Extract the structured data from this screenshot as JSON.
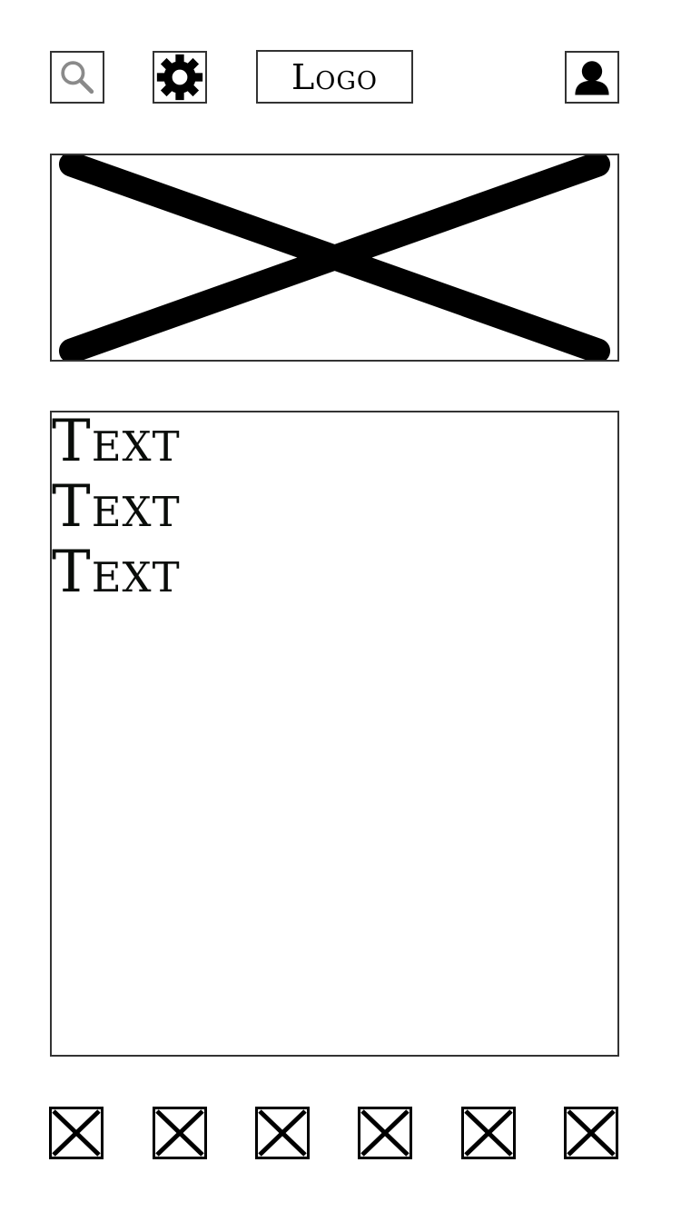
{
  "header": {
    "search_icon": "search-icon",
    "settings_icon": "gear-icon",
    "logo_label": "Logo",
    "profile_icon": "user-icon"
  },
  "hero": {
    "image": "image-placeholder-icon"
  },
  "content": {
    "lines": [
      "Text",
      "Text",
      "Text"
    ]
  },
  "bottom_nav": {
    "items": [
      {
        "icon": "placeholder-x-icon"
      },
      {
        "icon": "placeholder-x-icon"
      },
      {
        "icon": "placeholder-x-icon"
      },
      {
        "icon": "placeholder-x-icon"
      },
      {
        "icon": "placeholder-x-icon"
      },
      {
        "icon": "placeholder-x-icon"
      }
    ]
  },
  "colors": {
    "stroke": "#000000",
    "border": "#333333",
    "background": "#ffffff",
    "search_icon": "#8a8a8a"
  }
}
